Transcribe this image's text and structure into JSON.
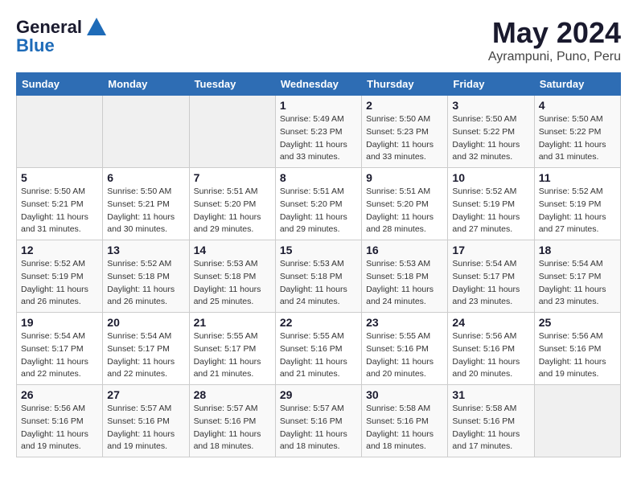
{
  "logo": {
    "general": "General",
    "blue": "Blue"
  },
  "title": "May 2024",
  "subtitle": "Ayrampuni, Puno, Peru",
  "days_of_week": [
    "Sunday",
    "Monday",
    "Tuesday",
    "Wednesday",
    "Thursday",
    "Friday",
    "Saturday"
  ],
  "weeks": [
    [
      {
        "day": "",
        "info": ""
      },
      {
        "day": "",
        "info": ""
      },
      {
        "day": "",
        "info": ""
      },
      {
        "day": "1",
        "info": "Sunrise: 5:49 AM\nSunset: 5:23 PM\nDaylight: 11 hours\nand 33 minutes."
      },
      {
        "day": "2",
        "info": "Sunrise: 5:50 AM\nSunset: 5:23 PM\nDaylight: 11 hours\nand 33 minutes."
      },
      {
        "day": "3",
        "info": "Sunrise: 5:50 AM\nSunset: 5:22 PM\nDaylight: 11 hours\nand 32 minutes."
      },
      {
        "day": "4",
        "info": "Sunrise: 5:50 AM\nSunset: 5:22 PM\nDaylight: 11 hours\nand 31 minutes."
      }
    ],
    [
      {
        "day": "5",
        "info": "Sunrise: 5:50 AM\nSunset: 5:21 PM\nDaylight: 11 hours\nand 31 minutes."
      },
      {
        "day": "6",
        "info": "Sunrise: 5:50 AM\nSunset: 5:21 PM\nDaylight: 11 hours\nand 30 minutes."
      },
      {
        "day": "7",
        "info": "Sunrise: 5:51 AM\nSunset: 5:20 PM\nDaylight: 11 hours\nand 29 minutes."
      },
      {
        "day": "8",
        "info": "Sunrise: 5:51 AM\nSunset: 5:20 PM\nDaylight: 11 hours\nand 29 minutes."
      },
      {
        "day": "9",
        "info": "Sunrise: 5:51 AM\nSunset: 5:20 PM\nDaylight: 11 hours\nand 28 minutes."
      },
      {
        "day": "10",
        "info": "Sunrise: 5:52 AM\nSunset: 5:19 PM\nDaylight: 11 hours\nand 27 minutes."
      },
      {
        "day": "11",
        "info": "Sunrise: 5:52 AM\nSunset: 5:19 PM\nDaylight: 11 hours\nand 27 minutes."
      }
    ],
    [
      {
        "day": "12",
        "info": "Sunrise: 5:52 AM\nSunset: 5:19 PM\nDaylight: 11 hours\nand 26 minutes."
      },
      {
        "day": "13",
        "info": "Sunrise: 5:52 AM\nSunset: 5:18 PM\nDaylight: 11 hours\nand 26 minutes."
      },
      {
        "day": "14",
        "info": "Sunrise: 5:53 AM\nSunset: 5:18 PM\nDaylight: 11 hours\nand 25 minutes."
      },
      {
        "day": "15",
        "info": "Sunrise: 5:53 AM\nSunset: 5:18 PM\nDaylight: 11 hours\nand 24 minutes."
      },
      {
        "day": "16",
        "info": "Sunrise: 5:53 AM\nSunset: 5:18 PM\nDaylight: 11 hours\nand 24 minutes."
      },
      {
        "day": "17",
        "info": "Sunrise: 5:54 AM\nSunset: 5:17 PM\nDaylight: 11 hours\nand 23 minutes."
      },
      {
        "day": "18",
        "info": "Sunrise: 5:54 AM\nSunset: 5:17 PM\nDaylight: 11 hours\nand 23 minutes."
      }
    ],
    [
      {
        "day": "19",
        "info": "Sunrise: 5:54 AM\nSunset: 5:17 PM\nDaylight: 11 hours\nand 22 minutes."
      },
      {
        "day": "20",
        "info": "Sunrise: 5:54 AM\nSunset: 5:17 PM\nDaylight: 11 hours\nand 22 minutes."
      },
      {
        "day": "21",
        "info": "Sunrise: 5:55 AM\nSunset: 5:17 PM\nDaylight: 11 hours\nand 21 minutes."
      },
      {
        "day": "22",
        "info": "Sunrise: 5:55 AM\nSunset: 5:16 PM\nDaylight: 11 hours\nand 21 minutes."
      },
      {
        "day": "23",
        "info": "Sunrise: 5:55 AM\nSunset: 5:16 PM\nDaylight: 11 hours\nand 20 minutes."
      },
      {
        "day": "24",
        "info": "Sunrise: 5:56 AM\nSunset: 5:16 PM\nDaylight: 11 hours\nand 20 minutes."
      },
      {
        "day": "25",
        "info": "Sunrise: 5:56 AM\nSunset: 5:16 PM\nDaylight: 11 hours\nand 19 minutes."
      }
    ],
    [
      {
        "day": "26",
        "info": "Sunrise: 5:56 AM\nSunset: 5:16 PM\nDaylight: 11 hours\nand 19 minutes."
      },
      {
        "day": "27",
        "info": "Sunrise: 5:57 AM\nSunset: 5:16 PM\nDaylight: 11 hours\nand 19 minutes."
      },
      {
        "day": "28",
        "info": "Sunrise: 5:57 AM\nSunset: 5:16 PM\nDaylight: 11 hours\nand 18 minutes."
      },
      {
        "day": "29",
        "info": "Sunrise: 5:57 AM\nSunset: 5:16 PM\nDaylight: 11 hours\nand 18 minutes."
      },
      {
        "day": "30",
        "info": "Sunrise: 5:58 AM\nSunset: 5:16 PM\nDaylight: 11 hours\nand 18 minutes."
      },
      {
        "day": "31",
        "info": "Sunrise: 5:58 AM\nSunset: 5:16 PM\nDaylight: 11 hours\nand 17 minutes."
      },
      {
        "day": "",
        "info": ""
      }
    ]
  ]
}
